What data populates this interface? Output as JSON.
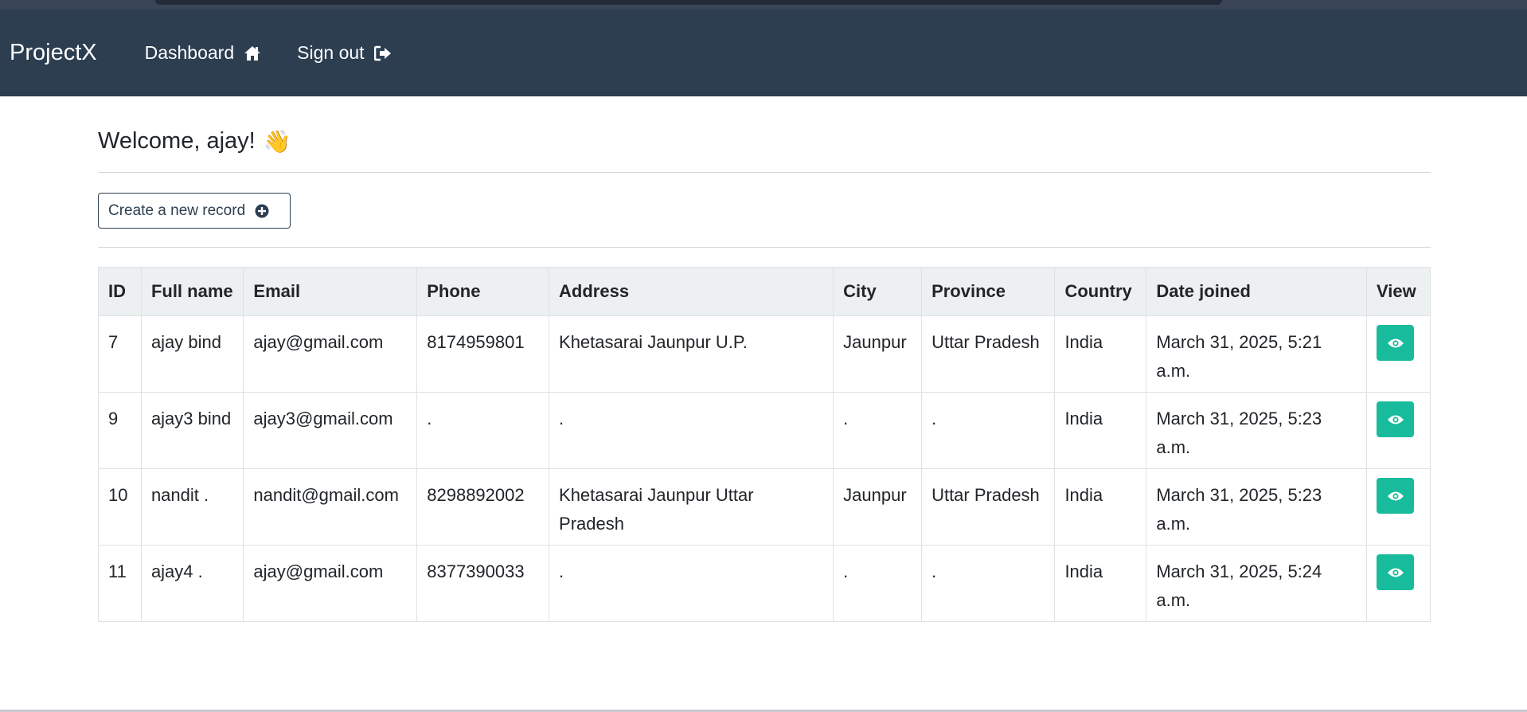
{
  "app": {
    "brand": "ProjectX",
    "nav": {
      "dashboard_label": "Dashboard",
      "dashboard_icon": "home-icon",
      "signout_label": "Sign out",
      "signout_icon": "sign-out-icon"
    }
  },
  "main": {
    "welcome_text": "Welcome, ajay!",
    "welcome_emoji": "👋",
    "create_button_label": "Create a new record",
    "create_button_icon": "plus-circle-icon"
  },
  "table": {
    "headers": {
      "id": "ID",
      "full_name": "Full name",
      "email": "Email",
      "phone": "Phone",
      "address": "Address",
      "city": "City",
      "province": "Province",
      "country": "Country",
      "date_joined": "Date joined",
      "view": "View"
    },
    "rows": [
      {
        "id": "7",
        "full_name": "ajay bind",
        "email": "ajay@gmail.com",
        "phone": "8174959801",
        "address": "Khetasarai Jaunpur U.P.",
        "city": "Jaunpur",
        "province": "Uttar Pradesh",
        "country": "India",
        "date_joined": "March 31, 2025, 5:21 a.m."
      },
      {
        "id": "9",
        "full_name": "ajay3 bind",
        "email": "ajay3@gmail.com",
        "phone": ".",
        "address": ".",
        "city": ".",
        "province": ".",
        "country": "India",
        "date_joined": "March 31, 2025, 5:23 a.m."
      },
      {
        "id": "10",
        "full_name": "nandit .",
        "email": "nandit@gmail.com",
        "phone": "8298892002",
        "address": "Khetasarai Jaunpur Uttar Pradesh",
        "city": "Jaunpur",
        "province": "Uttar Pradesh",
        "country": "India",
        "date_joined": "March 31, 2025, 5:23 a.m."
      },
      {
        "id": "11",
        "full_name": "ajay4 .",
        "email": "ajay@gmail.com",
        "phone": "8377390033",
        "address": ".",
        "city": ".",
        "province": ".",
        "country": "India",
        "date_joined": "March 31, 2025, 5:24 a.m."
      }
    ],
    "view_icon": "eye-icon"
  },
  "colors": {
    "navbar": "#2c3e50",
    "header_bg": "#ecf0f1",
    "view_button": "#18bc9c"
  }
}
